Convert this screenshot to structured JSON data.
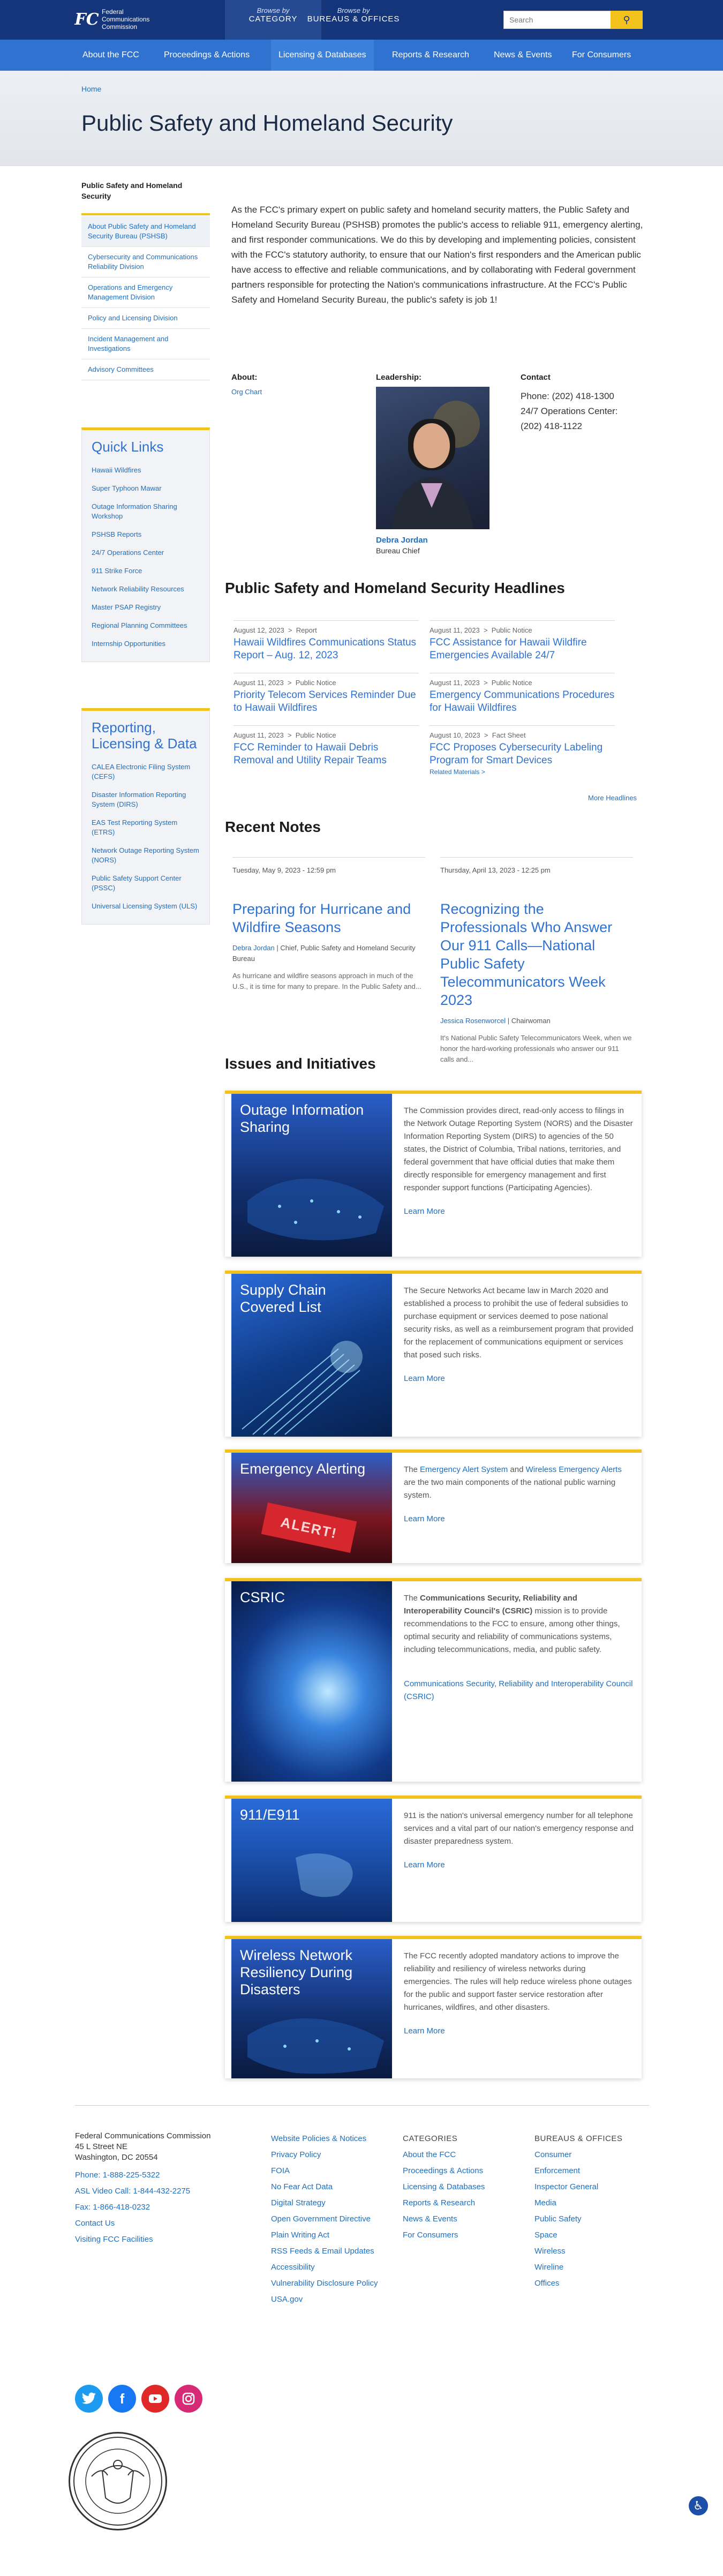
{
  "header": {
    "logo_lines": [
      "Federal",
      "Communications",
      "Commission"
    ],
    "browse_category": {
      "top": "Browse by",
      "bottom": "CATEGORY"
    },
    "browse_bureaus": {
      "top": "Browse by",
      "bottom": "BUREAUS & OFFICES"
    },
    "search_placeholder": "Search"
  },
  "nav": [
    "About the FCC",
    "Proceedings & Actions",
    "Licensing & Databases",
    "Reports & Research",
    "News & Events",
    "For Consumers"
  ],
  "breadcrumb": "Home",
  "page_title": "Public Safety and Homeland Security",
  "sidebar": {
    "title": "Public Safety and Homeland Security",
    "items": [
      "About Public Safety and Homeland Security Bureau (PSHSB)",
      "Cybersecurity and Communications Reliability Division",
      "Operations and Emergency Management Division",
      "Policy and Licensing Division",
      "Incident Management and Investigations",
      "Advisory Committees"
    ],
    "quick_links": {
      "title": "Quick Links",
      "items": [
        "Hawaii Wildfires",
        "Super Typhoon Mawar",
        "Outage Information Sharing Workshop",
        "PSHSB Reports",
        "24/7 Operations Center",
        "911 Strike Force",
        "Network Reliability Resources",
        "Master PSAP Registry",
        "Regional Planning Committees",
        "Internship Opportunities"
      ]
    },
    "reporting": {
      "title": "Reporting, Licensing & Data",
      "items": [
        "CALEA Electronic Filing System (CEFS)",
        "Disaster Information Reporting System (DIRS)",
        "EAS Test Reporting System (ETRS)",
        "Network Outage Reporting System (NORS)",
        "Public Safety Support Center (PSSC)",
        "Universal Licensing System (ULS)"
      ]
    }
  },
  "intro": "As the FCC's primary expert on public safety and homeland security matters, the Public Safety and Homeland Security Bureau (PSHSB) promotes the public's access to reliable 911, emergency alerting, and first responder communications.  We do this by developing and implementing policies, consistent with the FCC's statutory authority, to ensure that our Nation's first responders and the American public have access to effective and reliable communications, and by collaborating with Federal government partners responsible for protecting the Nation's communications infrastructure. At the FCC's Public Safety and Homeland Security Bureau, the public's safety is job 1!",
  "about": {
    "label": "About:",
    "link": "Org Chart"
  },
  "leadership": {
    "label": "Leadership:",
    "name": "Debra Jordan",
    "role": "Bureau Chief"
  },
  "contact": {
    "label": "Contact",
    "phone": "Phone: (202) 418-1300",
    "ops_label": "24/7 Operations Center:",
    "ops_phone": "(202) 418-1122"
  },
  "headlines": {
    "title": "Public Safety and Homeland Security Headlines",
    "items": [
      {
        "date": "August 12, 2023",
        "type": "Report",
        "title": "Hawaii Wildfires Communications Status Report – Aug. 12, 2023"
      },
      {
        "date": "August 11, 2023",
        "type": "Public Notice",
        "title": "FCC Assistance for Hawaii Wildfire Emergencies Available 24/7"
      },
      {
        "date": "August 11, 2023",
        "type": "Public Notice",
        "title": "Priority Telecom Services Reminder Due to Hawaii Wildfires"
      },
      {
        "date": "August 11, 2023",
        "type": "Public Notice",
        "title": "Emergency Communications Procedures for Hawaii Wildfires"
      },
      {
        "date": "August 11, 2023",
        "type": "Public Notice",
        "title": "FCC Reminder to Hawaii Debris Removal and Utility Repair Teams"
      },
      {
        "date": "August 10, 2023",
        "type": "Fact Sheet",
        "title": "FCC Proposes Cybersecurity Labeling Program for Smart Devices",
        "extra": "Related Materials >"
      }
    ],
    "more": "More Headlines"
  },
  "notes": {
    "title": "Recent Notes",
    "items": [
      {
        "date": "Tuesday, May 9, 2023 - 12:59 pm",
        "title": "Preparing for Hurricane and Wildfire Seasons",
        "author": "Debra Jordan",
        "author_role": " | Chief, Public Safety and Homeland Security Bureau",
        "excerpt": "As hurricane and wildfire seasons approach in much of the U.S., it is time for many to prepare. In the Public Safety and..."
      },
      {
        "date": "Thursday, April 13, 2023 - 12:25 pm",
        "title": "Recognizing the Professionals Who Answer Our 911 Calls—National Public Safety Telecommunicators Week 2023",
        "author": "Jessica Rosenworcel",
        "author_role": " | Chairwoman",
        "excerpt": "It's National Public Safety Telecommunicators Week, when we honor the hard-working professionals who answer our 911 calls and..."
      }
    ]
  },
  "issues": {
    "title": "Issues and Initiatives",
    "cards": [
      {
        "title": "Outage Information Sharing",
        "body": "The Commission provides direct, read-only access to filings in the Network Outage Reporting System (NORS) and the Disaster Information Reporting System (DIRS) to agencies of the 50 states, the District of Columbia, Tribal nations, territories, and federal government that have official duties that make them directly responsible for emergency management and first responder support functions (Participating Agencies).",
        "link": "Learn More"
      },
      {
        "title": "Supply Chain Covered List",
        "body": "The Secure Networks Act became law in March 2020 and established a process to prohibit the use of federal subsidies to purchase equipment or services deemed to pose national security risks, as well as a reimbursement program that provided for the replacement of communications equipment or services that posed such risks.",
        "link": "Learn More"
      },
      {
        "title": "Emergency Alerting",
        "body_pre": "The ",
        "body_link1": "Emergency Alert System",
        "body_mid": " and ",
        "body_link2": "Wireless Emergency Alerts",
        "body_post": " are the two main components of the national public warning system.",
        "link": "Learn More",
        "image_text": "ALERT!"
      },
      {
        "title": "CSRIC",
        "body_pre": "The ",
        "body_bold": "Communications Security, Reliability and Interoperability Council's (CSRIC)",
        "body_post": " mission is to provide recommendations to the FCC to ensure, among other things, optimal security and reliability of communications systems, including telecommunications, media, and public safety.",
        "link": "Communications Security, Reliability and Interoperability Council (CSRIC)"
      },
      {
        "title": "911/E911",
        "body": "911 is the nation's universal emergency number for all telephone services and a vital part of our nation's emergency response and disaster preparedness system.",
        "link": "Learn More"
      },
      {
        "title": "Wireless Network Resiliency During Disasters",
        "body": "The FCC recently adopted mandatory actions to improve the reliability and resiliency of wireless networks during emergencies. The rules will help reduce wireless phone outages for the public and support faster service restoration after hurricanes, wildfires, and other disasters.",
        "link": "Learn More"
      }
    ]
  },
  "footer": {
    "address": [
      "Federal Communications Commission",
      "45 L Street NE",
      "Washington, DC 20554"
    ],
    "contact_links": [
      "Phone: 1-888-225-5322",
      "ASL Video Call: 1-844-432-2275",
      "Fax: 1-866-418-0232",
      "Contact Us",
      "Visiting FCC Facilities"
    ],
    "policy_links": [
      "Website Policies & Notices",
      "Privacy Policy",
      "FOIA",
      "No Fear Act Data",
      "Digital Strategy",
      "Open Government Directive",
      "Plain Writing Act",
      "RSS Feeds & Email Updates",
      "Accessibility",
      "Vulnerability Disclosure Policy",
      "USA.gov"
    ],
    "categories": {
      "title": "CATEGORIES",
      "items": [
        "About the FCC",
        "Proceedings & Actions",
        "Licensing & Databases",
        "Reports & Research",
        "News & Events",
        "For Consumers"
      ]
    },
    "bureaus": {
      "title": "BUREAUS & OFFICES",
      "items": [
        "Consumer",
        "Enforcement",
        "Inspector General",
        "Media",
        "Public Safety",
        "Space",
        "Wireless",
        "Wireline",
        "Offices"
      ]
    }
  },
  "colors": {
    "header": "#14357a",
    "nav": "#2f72cf",
    "accent": "#f3c11c",
    "link": "#1e6fbf",
    "twitter": "#1d9bf0",
    "facebook": "#1877f2",
    "youtube": "#e02828",
    "instagram": "#d62976"
  }
}
